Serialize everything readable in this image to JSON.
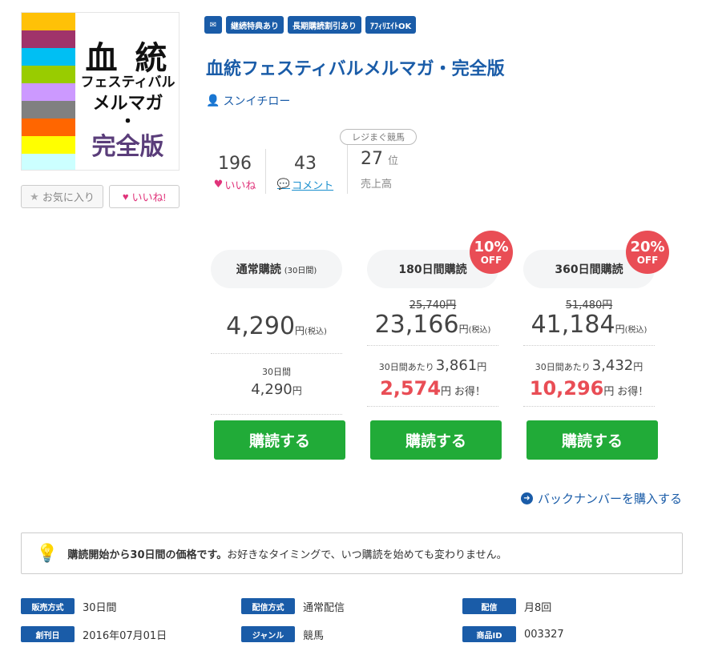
{
  "cover": {
    "stripe_colors": [
      "#ffc107",
      "#a0336a",
      "#00bff3",
      "#99cc00",
      "#cc99ff",
      "#808080",
      "#ff6600",
      "#ffff00",
      "#ccffff"
    ],
    "line1": "血 統",
    "line2": "フェスティバル",
    "line3": "メルマガ",
    "line4": "・",
    "line5": "完全版"
  },
  "actions": {
    "favorite_label": "お気に入り",
    "like_label": "いいね!"
  },
  "badges": [
    "継続特典あり",
    "長期購読割引あり",
    "ｱﾌｨﾘｴｲﾄOK"
  ],
  "product": {
    "title": "血統フェスティバルメルマガ・完全版",
    "author": "スンイチロー"
  },
  "stats": {
    "likes": "196",
    "likes_label": "いいね",
    "comments": "43",
    "comments_label": "コメント",
    "rank_category": "レジまぐ競馬",
    "rank": "27",
    "rank_unit": "位",
    "rank_label": "売上高"
  },
  "plans": [
    {
      "name": "通常購読",
      "period_note": "(30日間)",
      "original_price": "",
      "price": "4,290",
      "yen": "円",
      "tax": "(税込)",
      "per_label": "30日間",
      "per_value": "4,290",
      "per_unit": "円",
      "buy_label": "購読する"
    },
    {
      "name": "180日間購読",
      "discount": "10%",
      "off": "OFF",
      "original_price": "25,740円",
      "price": "23,166",
      "yen": "円",
      "tax": "(税込)",
      "per_label": "30日間あたり",
      "per_value": "3,861",
      "per_unit": "円",
      "saving": "2,574",
      "saving_unit": "円",
      "saving_suffix": "お得！",
      "buy_label": "購読する"
    },
    {
      "name": "360日間購読",
      "discount": "20%",
      "off": "OFF",
      "original_price": "51,480円",
      "price": "41,184",
      "yen": "円",
      "tax": "(税込)",
      "per_label": "30日間あたり",
      "per_value": "3,432",
      "per_unit": "円",
      "saving": "10,296",
      "saving_unit": "円",
      "saving_suffix": "お得！",
      "buy_label": "購読する"
    }
  ],
  "backnumber_label": "バックナンバーを購入する",
  "notice": {
    "bold": "購読開始から30日間の価格です。",
    "text": "お好きなタイミングで、いつ購読を始めても変わりません。"
  },
  "info": [
    {
      "label": "販売方式",
      "value": "30日間"
    },
    {
      "label": "配信方式",
      "value": "通常配信"
    },
    {
      "label": "配信",
      "value": "月8回"
    },
    {
      "label": "創刊日",
      "value": "2016年07月01日"
    },
    {
      "label": "ジャンル",
      "value": "競馬"
    },
    {
      "label": "商品ID",
      "value": "003327"
    }
  ],
  "colors": {
    "brand": "#1a5ca8",
    "buy": "#21ab38",
    "discount": "#e94d55",
    "like": "#e0337a"
  }
}
